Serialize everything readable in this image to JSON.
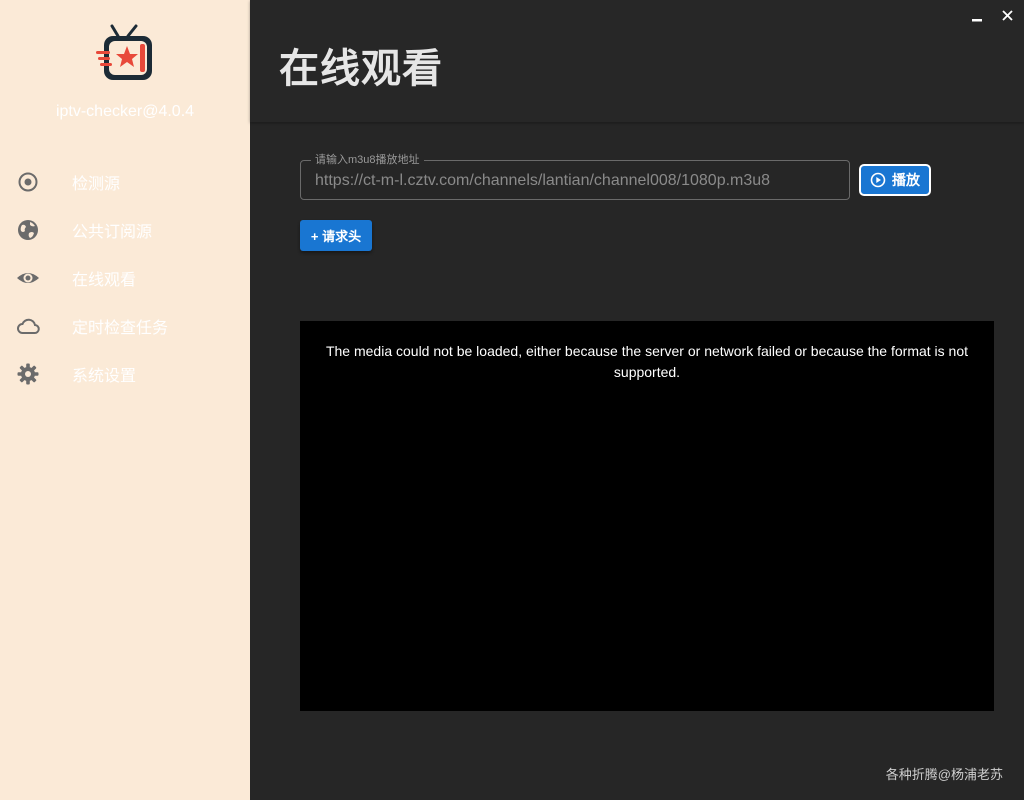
{
  "sidebar": {
    "logo_icon": "tv-star-logo-icon",
    "version": "iptv-checker@4.0.4",
    "items": [
      {
        "label": "检测源",
        "icon": "radio-target-icon"
      },
      {
        "label": "公共订阅源",
        "icon": "globe-icon"
      },
      {
        "label": "在线观看",
        "icon": "eye-icon"
      },
      {
        "label": "定时检查任务",
        "icon": "cloud-icon"
      },
      {
        "label": "系统设置",
        "icon": "gear-icon"
      }
    ]
  },
  "window": {
    "minimize_icon": "minimize-icon",
    "close_icon": "close-icon"
  },
  "main": {
    "title": "在线观看",
    "url_field": {
      "label": "请输入m3u8播放地址",
      "value": "https://ct-m-l.cztv.com/channels/lantian/channel008/1080p.m3u8"
    },
    "play_button": {
      "label": "播放",
      "icon": "play-circle-icon"
    },
    "headers_button": {
      "label": "+ 请求头"
    },
    "video": {
      "error_message": "The media could not be loaded, either because the server or network failed or because the format is not supported."
    }
  },
  "footer": {
    "text": "各种折腾@杨浦老苏"
  },
  "colors": {
    "sidebar_bg": "#fbead7",
    "main_bg": "#262626",
    "accent": "#1976d2",
    "icon_color": "#6b6b6b"
  }
}
